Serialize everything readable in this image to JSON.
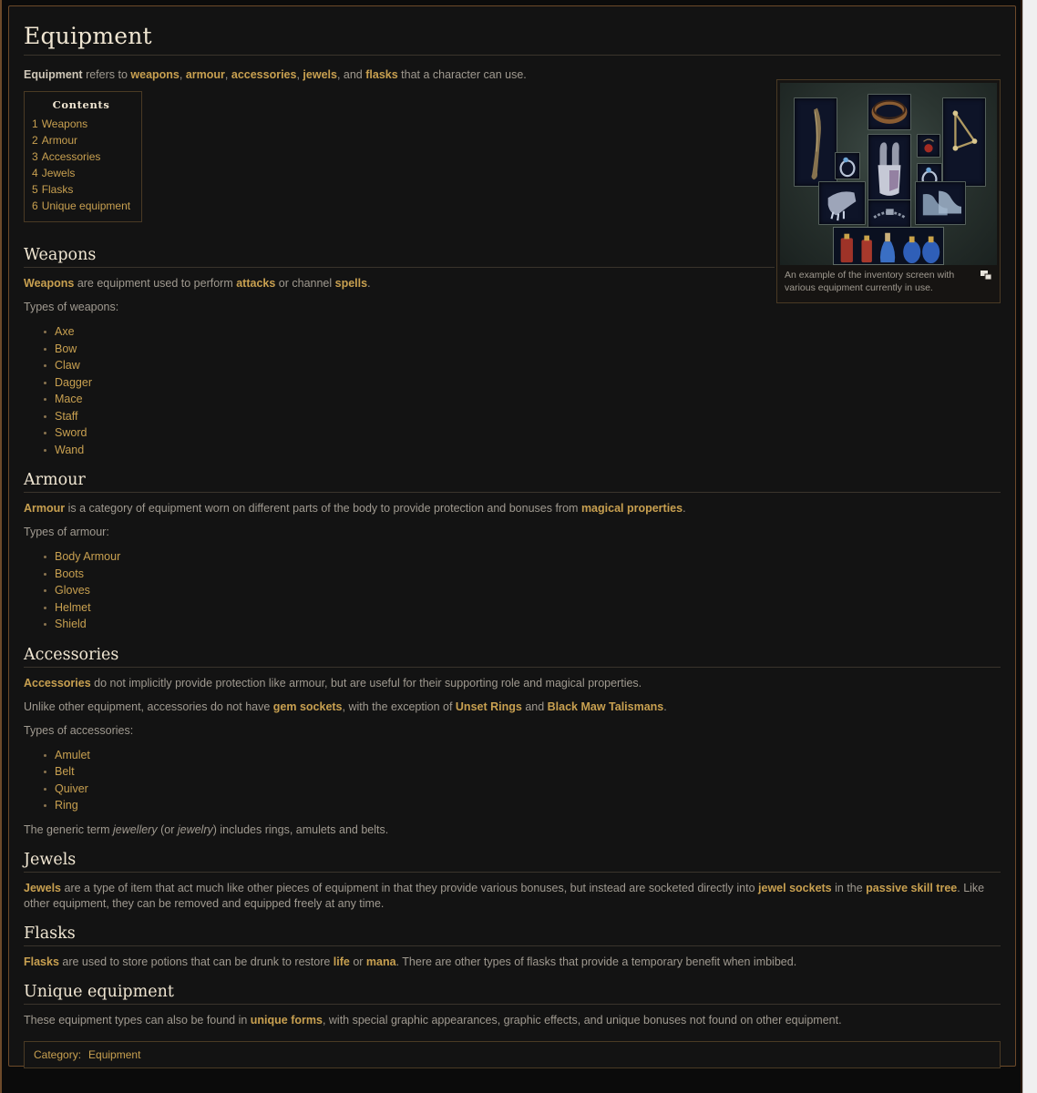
{
  "page": {
    "title": "Equipment",
    "intro_parts": [
      {
        "t": "Equipment",
        "k": "bold"
      },
      {
        "t": " refers to ",
        "k": "plain"
      },
      {
        "t": "weapons",
        "k": "link"
      },
      {
        "t": ", ",
        "k": "plain"
      },
      {
        "t": "armour",
        "k": "link"
      },
      {
        "t": ", ",
        "k": "plain"
      },
      {
        "t": "accessories",
        "k": "link"
      },
      {
        "t": ", ",
        "k": "plain"
      },
      {
        "t": "jewels",
        "k": "link"
      },
      {
        "t": ", and ",
        "k": "plain"
      },
      {
        "t": "flasks",
        "k": "link"
      },
      {
        "t": " that a character can use.",
        "k": "plain"
      }
    ]
  },
  "toc": {
    "title": "Contents",
    "items": [
      {
        "num": "1",
        "label": "Weapons"
      },
      {
        "num": "2",
        "label": "Armour"
      },
      {
        "num": "3",
        "label": "Accessories"
      },
      {
        "num": "4",
        "label": "Jewels"
      },
      {
        "num": "5",
        "label": "Flasks"
      },
      {
        "num": "6",
        "label": "Unique equipment"
      }
    ]
  },
  "thumbnail": {
    "caption": "An example of the inventory screen with various equipment currently in use.",
    "expand_icon": "expand-icon"
  },
  "sections": {
    "weapons": {
      "heading": "Weapons",
      "lead_link": "Weapons",
      "lead_rest_1": " are equipment used to perform ",
      "lead_link_2": "attacks",
      "lead_rest_2": " or channel ",
      "lead_link_3": "spells",
      "lead_rest_3": ".",
      "types_label": "Types of weapons:",
      "types": [
        "Axe",
        "Bow",
        "Claw",
        "Dagger",
        "Mace",
        "Staff",
        "Sword",
        "Wand"
      ]
    },
    "armour": {
      "heading": "Armour",
      "lead_link": "Armour",
      "lead_rest_1": " is a category of equipment worn on different parts of the body to provide protection and bonuses from ",
      "lead_link_2": "magical properties",
      "lead_rest_2": ".",
      "types_label": "Types of armour:",
      "types": [
        "Body Armour",
        "Boots",
        "Gloves",
        "Helmet",
        "Shield"
      ]
    },
    "accessories": {
      "heading": "Accessories",
      "p1_link": "Accessories",
      "p1_rest": " do not implicitly provide protection like armour, but are useful for their supporting role and magical properties.",
      "p2_a": "Unlike other equipment, accessories do not have ",
      "p2_link1": "gem sockets",
      "p2_b": ", with the exception of ",
      "p2_link2": "Unset Rings",
      "p2_c": " and ",
      "p2_link3": "Black Maw Talismans",
      "p2_d": ".",
      "types_label": "Types of accessories:",
      "types": [
        "Amulet",
        "Belt",
        "Quiver",
        "Ring"
      ],
      "footer_a": "The generic term ",
      "footer_em1": "jewellery",
      "footer_b": " (or ",
      "footer_em2": "jewelry",
      "footer_c": ") includes rings, amulets and belts."
    },
    "jewels": {
      "heading": "Jewels",
      "p_link1": "Jewels",
      "p_a": " are a type of item that act much like other pieces of equipment in that they provide various bonuses, but instead are socketed directly into ",
      "p_link2": "jewel sockets",
      "p_b": " in the ",
      "p_link3": "passive skill tree",
      "p_c": ". Like other equipment, they can be removed and equipped freely at any time."
    },
    "flasks": {
      "heading": "Flasks",
      "p_link1": "Flasks",
      "p_a": " are used to store potions that can be drunk to restore ",
      "p_link2": "life",
      "p_b": " or ",
      "p_link3": "mana",
      "p_c": ". There are other types of flasks that provide a temporary benefit when imbibed."
    },
    "unique": {
      "heading": "Unique equipment",
      "p_a": "These equipment types can also be found in ",
      "p_link1": "unique forms",
      "p_b": ", with special graphic appearances, graphic effects, and unique bonuses not found on other equipment."
    }
  },
  "category_footer": {
    "label": "Category:",
    "value": "Equipment"
  },
  "colors": {
    "link": "#c8a050",
    "heading": "#f0e6d2",
    "body_text": "#a09a90",
    "background": "#131313",
    "border": "#6d4a2a",
    "rule": "#3a342c"
  }
}
